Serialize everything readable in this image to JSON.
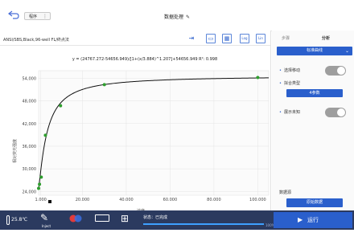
{
  "header": {
    "menu_label": "程序",
    "menu_dots": "⋮",
    "title": "数据处理"
  },
  "left": {
    "plate_label": "ANSI/SBS,Black,96-well   FL/终点法",
    "tools": [
      "⇥",
      "▭",
      "▦",
      "Log",
      "Lin"
    ]
  },
  "chart_data": {
    "type": "scatter",
    "equation": "y = (24767.272-54656.949)/[1+(x/3.884)^1.207]+54656.949    R²: 0.998",
    "xlabel": "浓度",
    "ylabel": "相对荧光强度",
    "xlim": [
      0,
      105
    ],
    "ylim": [
      23000,
      56000
    ],
    "x_ticks": [
      "1.000",
      "20.000",
      "40.000",
      "60.000",
      "80.000",
      "100.000"
    ],
    "x_tick_values": [
      1,
      20,
      40,
      60,
      80,
      100
    ],
    "y_ticks": [
      "24,000",
      "30,000",
      "36,000",
      "42,000",
      "48,000",
      "54,000"
    ],
    "y_tick_values": [
      24000,
      30000,
      36000,
      42000,
      48000,
      54000
    ],
    "points": [
      {
        "x": 0.0,
        "y": 24800
      },
      {
        "x": 0.4,
        "y": 25900
      },
      {
        "x": 1.2,
        "y": 27800
      },
      {
        "x": 3.1,
        "y": 38900
      },
      {
        "x": 10.0,
        "y": 46700
      },
      {
        "x": 30.0,
        "y": 52300
      },
      {
        "x": 100.0,
        "y": 54200
      }
    ],
    "curve": {
      "a": 24767.272,
      "d": 54656.949,
      "c": 3.884,
      "b": 1.207
    },
    "point_color": "#2e9e2e",
    "curve_color": "#111111"
  },
  "right": {
    "tab_steps": "步骤",
    "tab_analysis": "分析",
    "dropdown_label": "标准曲线",
    "option_select": "选择移动",
    "option_fit": "拟合类型",
    "param_button": "4参数",
    "option_unknown": "展示未知",
    "data_source_label": "数据源",
    "orig_data_button": "原始数据"
  },
  "footer": {
    "temperature": "25.8℃",
    "inject_label": "Inject",
    "status": "状态：已完成",
    "progress_percent": 100,
    "progress_text": "100%",
    "run_label": "运行"
  },
  "colors": {
    "accent": "#2a5fcc",
    "footer_bg": "#2b3a5f"
  }
}
